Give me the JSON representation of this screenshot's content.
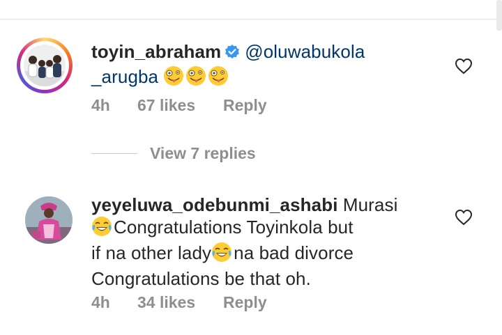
{
  "comments": [
    {
      "username": "toyin_abraham",
      "verified": true,
      "text_line1": "@oluwabukola",
      "text_line2": "_arugba",
      "emojis": [
        "zany-face",
        "zany-face",
        "zany-face"
      ],
      "time": "4h",
      "likes": "67 likes",
      "reply": "Reply"
    },
    {
      "username": "yeyeluwa_odebunmi_ashabi",
      "line1_text": "Murasi",
      "line2_text": "Congratulations Toyinkola but",
      "line3_a": "if na other lady",
      "line3_b": "na bad divorce",
      "line4": "Congratulations be that oh.",
      "emojis": [
        "tears-of-joy",
        "tears-of-joy"
      ],
      "time": "4h",
      "likes": "34 likes",
      "reply": "Reply"
    }
  ],
  "view_replies": "View 7 replies",
  "colors": {
    "mention": "#00376b",
    "meta": "#8e8e8e",
    "verified": "#3897f0",
    "text": "#262626"
  }
}
